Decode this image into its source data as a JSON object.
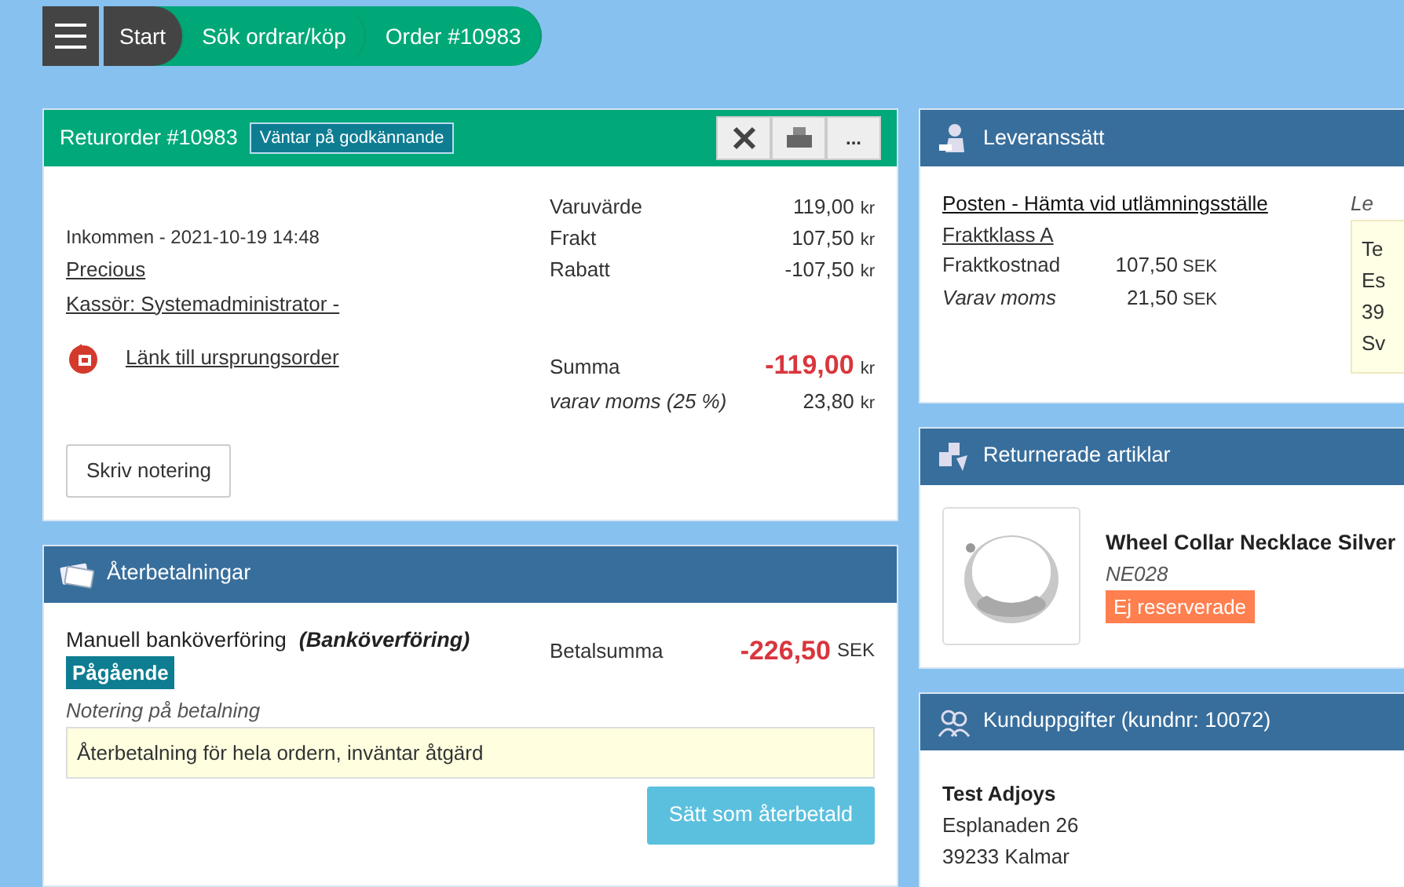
{
  "breadcrumb": [
    {
      "label": "Start",
      "kind": "home"
    },
    {
      "label": "Sök ordrar/köp",
      "kind": "link"
    },
    {
      "label": "Order #10983",
      "kind": "link"
    }
  ],
  "return_order": {
    "title": "Returorder #10983",
    "status": "Väntar på godkännande",
    "actions": [
      {
        "kind": "close"
      },
      {
        "kind": "print"
      },
      {
        "kind": "more",
        "label": "..."
      }
    ],
    "received": "Inkommen - 2021-10-19 14:48",
    "customer_link": "Precious",
    "cashier_link": "Kassör: Systemadministrator -",
    "origin_link": "Länk till ursprungsorder",
    "totals": [
      {
        "label": "Varuvärde",
        "value": "119,00",
        "unit": "kr",
        "kind": "plain"
      },
      {
        "label": "Frakt",
        "value": "107,50",
        "unit": "kr",
        "kind": "plain"
      },
      {
        "label": "Rabatt",
        "value": "-107,50",
        "unit": "kr",
        "kind": "plain"
      },
      {
        "label": "Summa",
        "value": "-119,00",
        "unit": "kr",
        "kind": "total"
      },
      {
        "label": "varav moms (25 %)",
        "value": "23,80",
        "unit": "kr",
        "kind": "vat"
      }
    ],
    "note_button": "Skriv notering"
  },
  "refunds": {
    "title": "Återbetalningar",
    "method": "Manuell banköverföring",
    "method_type": "(Banköverföring)",
    "status": "Pågående",
    "amount_label": "Betalsumma",
    "amount": "-226,50",
    "currency": "SEK",
    "note_label": "Notering på betalning",
    "note": "Återbetalning för hela ordern, inväntar åtgärd",
    "button": "Sätt som återbetald"
  },
  "delivery": {
    "title": "Leveranssätt",
    "method_link": "Posten - Hämta vid utlämningsställe",
    "class_link": "Fraktklass A",
    "rows": [
      {
        "label": "Fraktkostnad",
        "value": "107,50",
        "currency": "SEK",
        "kind": "plain"
      },
      {
        "label": "Varav moms",
        "value": "21,50",
        "currency": "SEK",
        "kind": "vat"
      }
    ],
    "address_label": "Le",
    "address_lines": [
      "Te",
      "Es",
      "39",
      "Sv"
    ]
  },
  "returned_items": {
    "title": "Returnerade artiklar",
    "items": [
      {
        "name": "Wheel Collar Necklace Silver",
        "sku": "NE028",
        "status": "Ej reserverade"
      }
    ]
  },
  "customer": {
    "title": "Kunduppgifter (kundnr: 10072)",
    "name": "Test Adjoys",
    "address_lines": [
      "Esplanaden 26",
      "39233 Kalmar"
    ]
  }
}
